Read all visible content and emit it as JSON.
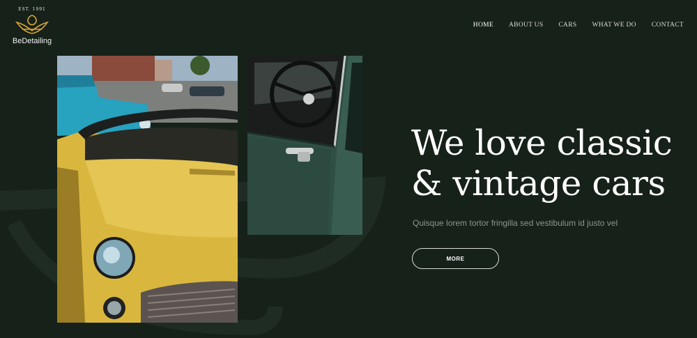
{
  "brand": {
    "established": "EST. 1991",
    "name": "BeDetailing"
  },
  "nav": {
    "items": [
      "HOME",
      "ABOUT US",
      "CARS",
      "WHAT WE DO",
      "CONTACT"
    ],
    "active": "HOME"
  },
  "hero": {
    "title_line1": "We love classic",
    "title_line2": "& vintage cars",
    "subtitle": "Quisque lorem tortor fringilla sed vestibulum id justo vel",
    "button_label": "MORE"
  },
  "colors": {
    "background": "#162119",
    "logo_gold": "#d9a53a",
    "car_yellow": "#d9b73e",
    "car_green": "#2f4e44"
  },
  "icons": {
    "logo": "winged-emblem-icon"
  }
}
